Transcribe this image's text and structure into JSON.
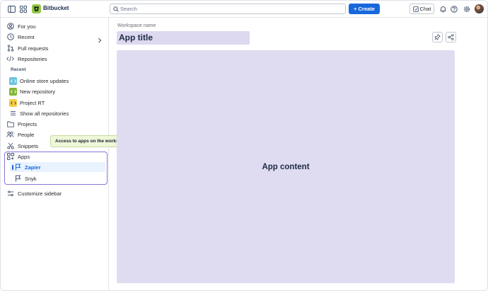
{
  "topbar": {
    "product_name": "Bitbucket",
    "search_placeholder": "Search",
    "create_label": "Create",
    "chat_label": "Chat"
  },
  "sidebar": {
    "for_you": "For you",
    "recent": "Recent",
    "pull_requests": "Pull requests",
    "repositories": "Repositories",
    "recent_section": "Recent",
    "repos": [
      {
        "label": "Online store updates",
        "color": "#6cc3e0"
      },
      {
        "label": "New repository",
        "color": "#82b536"
      },
      {
        "label": "Project RT",
        "color": "#f5cd47"
      }
    ],
    "show_all": "Show all repositories",
    "projects": "Projects",
    "people": "People",
    "snippets": "Snippets",
    "apps": "Apps",
    "apps_children": [
      {
        "label": "Zapier"
      },
      {
        "label": "Snyk"
      }
    ],
    "customize": "Customize sidebar"
  },
  "tooltip": "Access to apps on the workspace level",
  "main": {
    "workspace_name": "Workspace name",
    "app_title": "App title",
    "app_content": "App content"
  },
  "colors": {
    "accent": "#1868db",
    "highlight_border": "#8c75d9",
    "placeholder_fill": "#dfdcf1"
  }
}
